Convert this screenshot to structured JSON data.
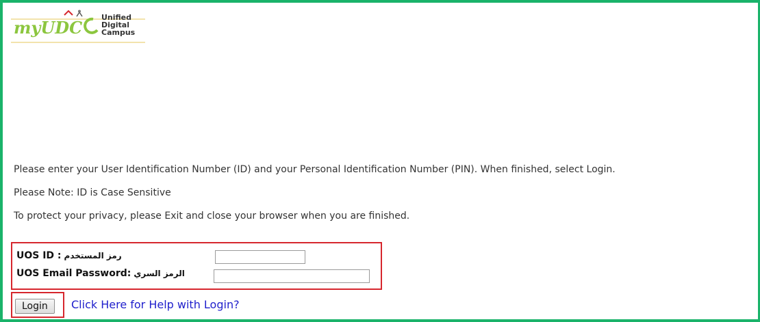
{
  "logo": {
    "word": "myUDC",
    "tag_line1": "Unified",
    "tag_line2": "Digital",
    "tag_line3": "Campus"
  },
  "instructions": {
    "line1": "Please enter your User Identification Number (ID) and your Personal Identification Number (PIN). When finished, select Login.",
    "line2": "Please Note: ID is Case Sensitive",
    "line3": "To protect your privacy, please Exit and close your browser when you are finished."
  },
  "form": {
    "id_label_en": "UOS ID :",
    "id_label_ar": "رمز المستخدم",
    "id_value": "",
    "password_label_en": "UOS Email Password:",
    "password_label_ar": "الرمز السري",
    "password_value": ""
  },
  "actions": {
    "login_label": "Login",
    "help_link": "Click Here for Help with Login?"
  },
  "colors": {
    "frame": "#1ab36a",
    "highlight": "#d6262d",
    "link": "#2020cc"
  }
}
